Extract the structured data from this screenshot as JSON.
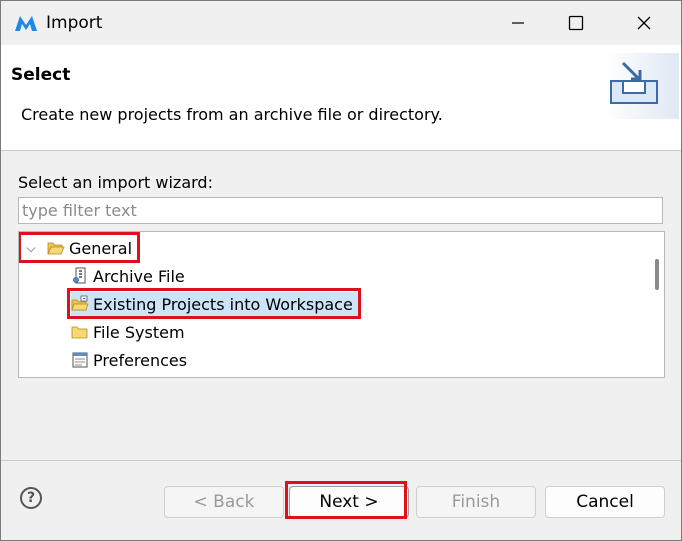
{
  "window": {
    "title": "Import",
    "app_icon": "eclipse-m-logo-icon"
  },
  "header": {
    "title": "Select",
    "description": "Create new projects from an archive file or directory.",
    "banner_icon": "import-wizard-banner-icon"
  },
  "wizard": {
    "label": "Select an import wizard:",
    "filter_placeholder": "type filter text",
    "filter_value": "",
    "tree": {
      "group": {
        "label": "General",
        "expanded": true,
        "icon": "open-folder-icon"
      },
      "items": [
        {
          "label": "Archive File",
          "icon": "archive-file-icon",
          "selected": false
        },
        {
          "label": "Existing Projects into Workspace",
          "icon": "existing-projects-icon",
          "selected": true
        },
        {
          "label": "File System",
          "icon": "folder-icon",
          "selected": false
        },
        {
          "label": "Preferences",
          "icon": "preferences-icon",
          "selected": false
        }
      ]
    }
  },
  "buttons": {
    "back": "< Back",
    "next": "Next >",
    "finish": "Finish",
    "cancel": "Cancel"
  },
  "colors": {
    "highlight": "#e0101a",
    "selection": "#cce4f7",
    "accent": "#1e88e5"
  }
}
